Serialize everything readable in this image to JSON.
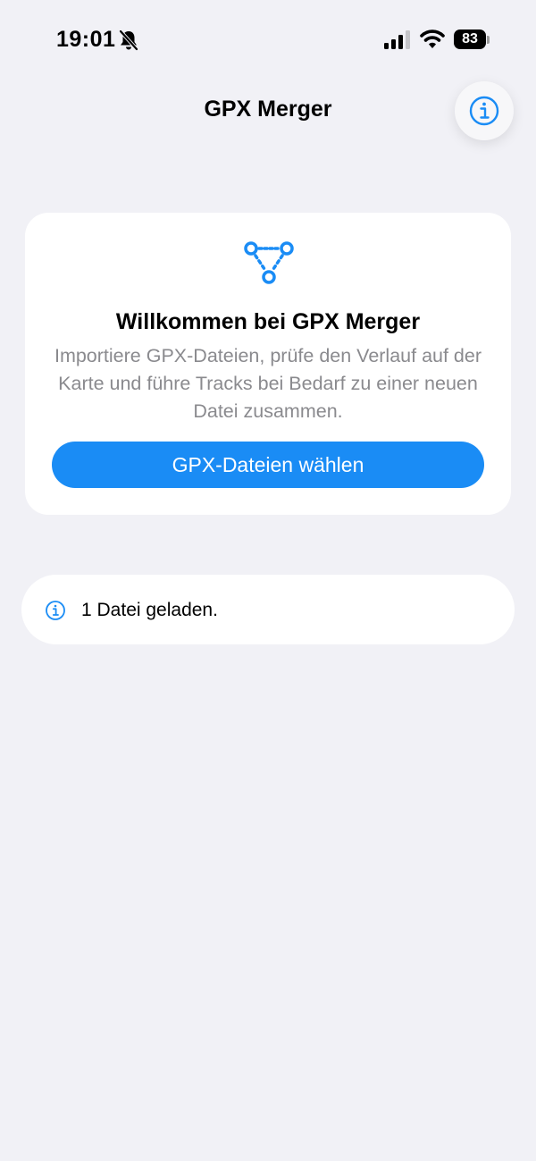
{
  "status_bar": {
    "time": "19:01",
    "battery_level": "83",
    "icons": [
      "bell-slash-icon",
      "cellular-signal-icon",
      "wifi-icon",
      "battery-icon"
    ]
  },
  "nav": {
    "title": "GPX Merger",
    "info_icon": "info-circle-icon"
  },
  "welcome": {
    "icon": "route-merge-icon",
    "title": "Willkommen bei GPX Merger",
    "description": "Importiere GPX-Dateien, prüfe den Verlauf auf der Karte und führe Tracks bei Bedarf zu einer neuen Datei zusammen.",
    "button_label": "GPX-Dateien wählen"
  },
  "status": {
    "icon": "info-circle-icon",
    "text": "1 Datei geladen."
  },
  "colors": {
    "background": "#f1f1f6",
    "accent": "#1a8cf5",
    "card": "#ffffff",
    "secondary_text": "#8a8a8e"
  }
}
